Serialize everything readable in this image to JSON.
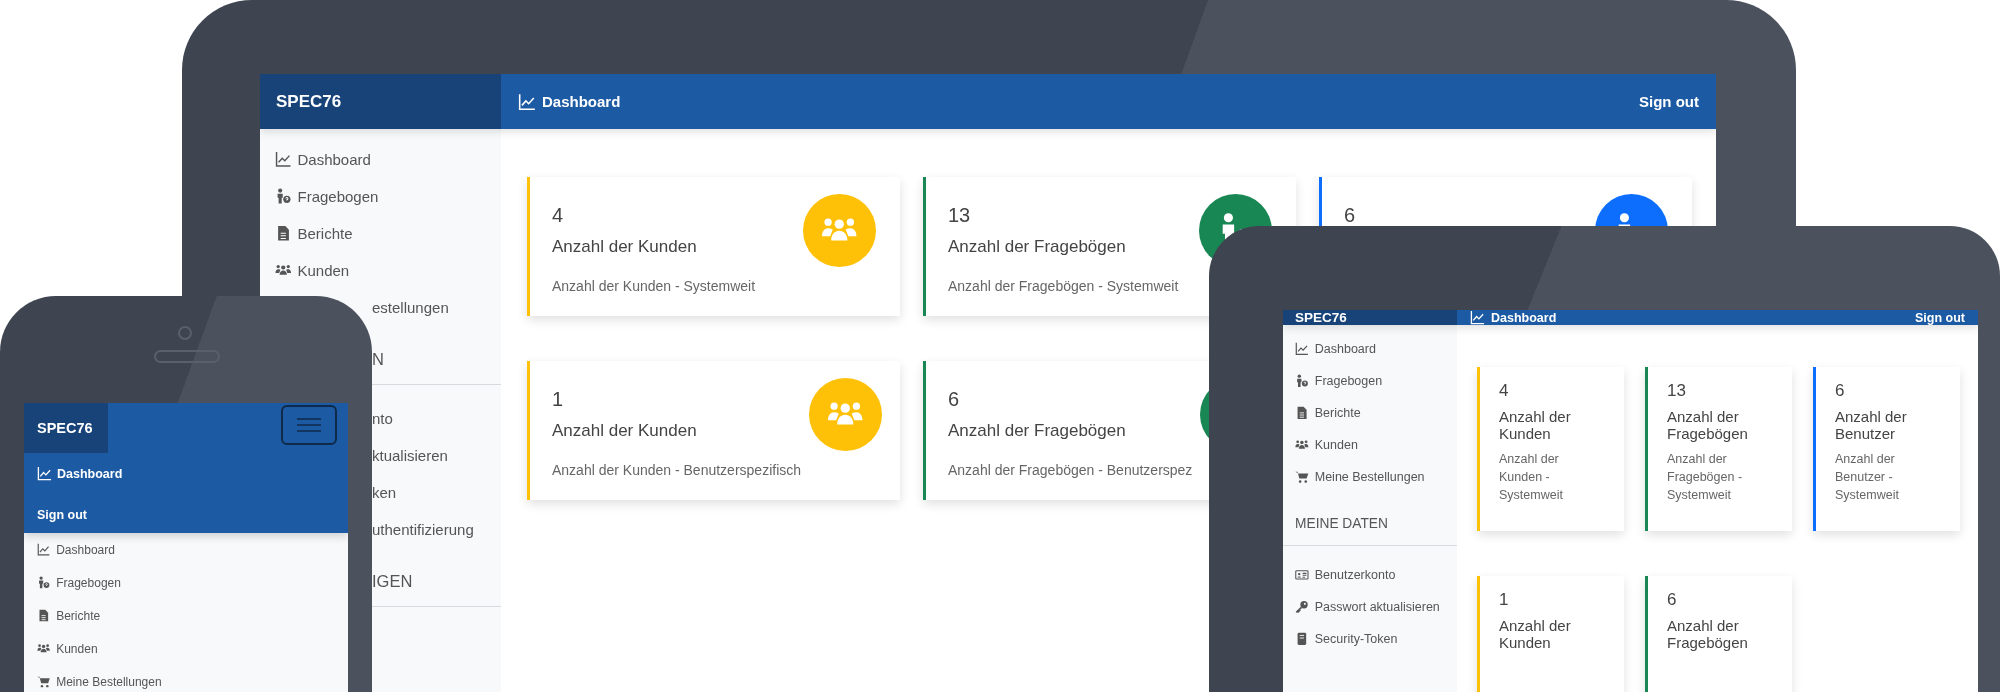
{
  "laptop": {
    "brand": "SPEC76",
    "nav_link": "Dashboard",
    "sign_out": "Sign out",
    "sidebar": [
      {
        "kind": "link",
        "label": "Dashboard"
      },
      {
        "kind": "link",
        "label": "Fragebogen"
      },
      {
        "kind": "link",
        "label": "Berichte"
      },
      {
        "kind": "link",
        "label": "Kunden"
      },
      {
        "kind": "fragment",
        "label": "estellungen"
      },
      {
        "kind": "fragment_heading",
        "label": "N"
      },
      {
        "kind": "fragment",
        "label": "nto"
      },
      {
        "kind": "fragment",
        "label": "ktualisieren"
      },
      {
        "kind": "fragment",
        "label": "ken"
      },
      {
        "kind": "fragment",
        "label": "uthentifizierung"
      },
      {
        "kind": "fragment_heading",
        "label": "IGEN"
      }
    ],
    "cards": [
      {
        "value": "4",
        "title": "Anzahl der Kunden",
        "subtitle": "Anzahl der Kunden - Systemweit",
        "color": "#ffc107"
      },
      {
        "value": "13",
        "title": "Anzahl der Fragebögen",
        "subtitle": "Anzahl der Fragebögen - Systemweit",
        "color": "#198754"
      },
      {
        "value": "6",
        "color": "#0d6efd"
      },
      {
        "value": "1",
        "title": "Anzahl der Kunden",
        "subtitle": "Anzahl der Kunden - Benutzerspezifisch",
        "color": "#ffc107"
      },
      {
        "value": "6",
        "title": "Anzahl der Fragebögen",
        "subtitle": "Anzahl der Fragebögen - Benutzerspez",
        "color": "#198754"
      }
    ]
  },
  "phone": {
    "brand": "SPEC76",
    "nav_links": [
      "Dashboard",
      "Sign out"
    ],
    "sidebar": [
      {
        "kind": "link",
        "label": "Dashboard"
      },
      {
        "kind": "link",
        "label": "Fragebogen"
      },
      {
        "kind": "link",
        "label": "Berichte"
      },
      {
        "kind": "link",
        "label": "Kunden"
      },
      {
        "kind": "link",
        "label": "Meine Bestellungen"
      }
    ]
  },
  "tablet": {
    "brand": "SPEC76",
    "nav_link": "Dashboard",
    "sign_out": "Sign out",
    "sidebar": [
      {
        "kind": "link",
        "label": "Dashboard"
      },
      {
        "kind": "link",
        "label": "Fragebogen"
      },
      {
        "kind": "link",
        "label": "Berichte"
      },
      {
        "kind": "link",
        "label": "Kunden"
      },
      {
        "kind": "link",
        "label": "Meine Bestellungen"
      },
      {
        "kind": "heading",
        "label": "MEINE DATEN"
      },
      {
        "kind": "link",
        "label": "Benutzerkonto"
      },
      {
        "kind": "link",
        "label": "Passwort aktualisieren"
      },
      {
        "kind": "link",
        "label": "Security-Token"
      }
    ],
    "cards": [
      {
        "value": "4",
        "title": "Anzahl der Kunden",
        "subtitle": "Anzahl der Kunden - Systemweit",
        "color": "#ffc107"
      },
      {
        "value": "13",
        "title": "Anzahl der Fragebögen",
        "subtitle": "Anzahl der Fragebögen - Systemweit",
        "color": "#198754"
      },
      {
        "value": "6",
        "title": "Anzahl der Benutzer",
        "subtitle": "Anzahl der Benutzer - Systemweit",
        "color": "#0d6efd"
      },
      {
        "value": "1",
        "title": "Anzahl der Kunden",
        "color": "#ffc107"
      },
      {
        "value": "6",
        "title": "Anzahl der Fragebögen",
        "color": "#198754"
      }
    ]
  }
}
